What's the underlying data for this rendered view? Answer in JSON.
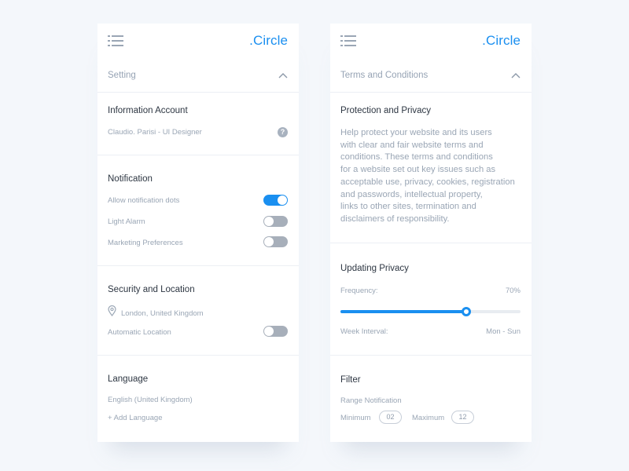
{
  "brand": {
    "name": ".Circle",
    "color": "#1a8ff0"
  },
  "settings_panel": {
    "header": "Setting",
    "information_account": {
      "title": "Information Account",
      "user": "Claudio. Parisi - UI Designer",
      "help_icon": "?"
    },
    "notification": {
      "title": "Notification",
      "items": [
        {
          "label": "Allow notification dots",
          "on": true
        },
        {
          "label": "Light Alarm",
          "on": false
        },
        {
          "label": "Marketing Preferences",
          "on": false
        }
      ]
    },
    "security": {
      "title": "Security and Location",
      "location": "London, United Kingdom",
      "automatic_label": "Automatic Location",
      "automatic_on": false
    },
    "language": {
      "title": "Language",
      "current": "English (United Kingdom)",
      "add_label": "+ Add Language"
    }
  },
  "terms_panel": {
    "header": "Terms and Conditions",
    "protection": {
      "title": "Protection and Privacy",
      "lines": [
        "Help protect your website and its users",
        "with clear and fair website terms and",
        "conditions. These terms and conditions",
        "for a website set out key issues such as",
        "acceptable use, privacy, cookies, registration",
        "and passwords, intellectual property,",
        "links to other sites, termination and",
        "disclaimers of responsibility."
      ]
    },
    "updating": {
      "title": "Updating Privacy",
      "frequency_label": "Frequency:",
      "frequency_value": "70%",
      "frequency_fraction": 0.7,
      "interval_label": "Week Interval:",
      "interval_value": "Mon - Sun"
    },
    "filter": {
      "title": "Filter",
      "subtitle": "Range Notification",
      "min_label": "Minimum",
      "min_value": "02",
      "max_label": "Maximum",
      "max_value": "12"
    }
  }
}
